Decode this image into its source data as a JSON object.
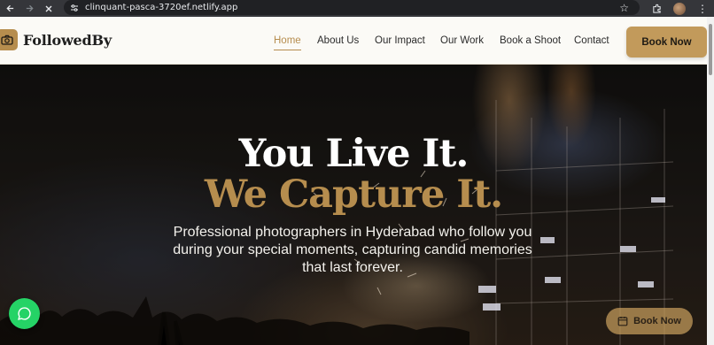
{
  "browser": {
    "url": "clinquant-pasca-3720ef.netlify.app",
    "icons": [
      "back-arrow-icon",
      "forward-arrow-icon",
      "stop-loading-icon",
      "site-settings-icon",
      "bookmark-star-icon",
      "extensions-icon",
      "profile-avatar",
      "more-menu-icon"
    ]
  },
  "header": {
    "brand": "FollowedBy",
    "nav": [
      {
        "label": "Home",
        "active": true
      },
      {
        "label": "About Us",
        "active": false
      },
      {
        "label": "Our Impact",
        "active": false
      },
      {
        "label": "Our Work",
        "active": false
      },
      {
        "label": "Book a Shoot",
        "active": false
      },
      {
        "label": "Contact",
        "active": false
      }
    ],
    "cta": "Book Now"
  },
  "hero": {
    "title_line1": "You Live It.",
    "title_line2": "We Capture It.",
    "subtitle": "Professional photographers in Hyderabad who follow you during your special moments, capturing candid memories that last forever."
  },
  "floating": {
    "book_label": "Book Now",
    "chat_icon": "chat-bubble-icon",
    "calendar_icon": "calendar-icon"
  },
  "colors": {
    "accent": "#b68d4e",
    "button": "#c29a5b",
    "whatsapp": "#25d366"
  }
}
